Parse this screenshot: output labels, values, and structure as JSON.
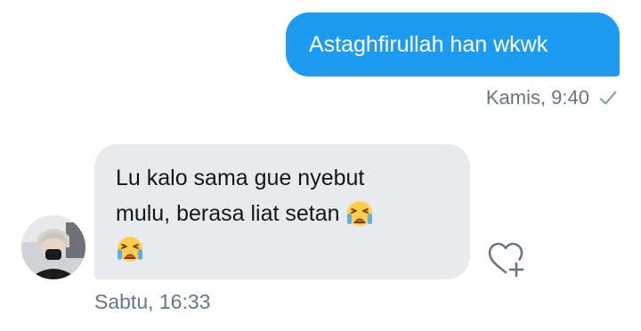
{
  "conversation": {
    "outgoing": {
      "text": "Astaghfirullah han wkwk",
      "timestamp": "Kamis, 9:40",
      "status_icon": "check-icon",
      "bubble_color": "#1d9bf0"
    },
    "incoming": {
      "line1": "Lu kalo sama gue nyebut",
      "line2": "mulu, berasa liat setan",
      "emoji": "loudly-crying-emoji",
      "timestamp": "Sabtu, 16:33",
      "bubble_color": "#e7ebf0",
      "react_icon": "heart-plus-icon"
    }
  },
  "colors": {
    "meta_text": "#687684",
    "body_text": "#14171a"
  }
}
